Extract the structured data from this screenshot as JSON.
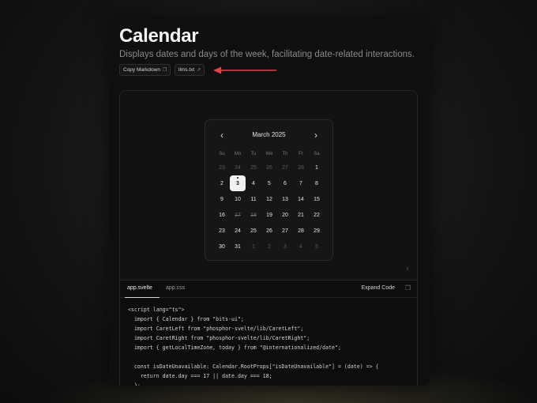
{
  "header": {
    "title": "Calendar",
    "subtitle": "Displays dates and days of the week, facilitating date-related interactions."
  },
  "actions": {
    "copy_markdown": "Copy Markdown",
    "llms": "llms.txt"
  },
  "colors": {
    "arrow": "#e0454a",
    "today_bg": "#f2f2f2"
  },
  "calendar": {
    "month": "March 2025",
    "weekdays": [
      "Su",
      "Mo",
      "Tu",
      "We",
      "Th",
      "Fr",
      "Sa"
    ],
    "weeks": [
      [
        {
          "d": "23",
          "s": "out"
        },
        {
          "d": "24",
          "s": "out"
        },
        {
          "d": "25",
          "s": "out"
        },
        {
          "d": "26",
          "s": "out"
        },
        {
          "d": "27",
          "s": "out"
        },
        {
          "d": "28",
          "s": "out"
        },
        {
          "d": "1",
          "s": ""
        }
      ],
      [
        {
          "d": "2",
          "s": ""
        },
        {
          "d": "3",
          "s": "today"
        },
        {
          "d": "4",
          "s": ""
        },
        {
          "d": "5",
          "s": ""
        },
        {
          "d": "6",
          "s": ""
        },
        {
          "d": "7",
          "s": ""
        },
        {
          "d": "8",
          "s": ""
        }
      ],
      [
        {
          "d": "9",
          "s": ""
        },
        {
          "d": "10",
          "s": ""
        },
        {
          "d": "11",
          "s": ""
        },
        {
          "d": "12",
          "s": ""
        },
        {
          "d": "13",
          "s": ""
        },
        {
          "d": "14",
          "s": ""
        },
        {
          "d": "15",
          "s": ""
        }
      ],
      [
        {
          "d": "16",
          "s": ""
        },
        {
          "d": "17",
          "s": "unavailable"
        },
        {
          "d": "18",
          "s": "unavailable"
        },
        {
          "d": "19",
          "s": ""
        },
        {
          "d": "20",
          "s": ""
        },
        {
          "d": "21",
          "s": ""
        },
        {
          "d": "22",
          "s": ""
        }
      ],
      [
        {
          "d": "23",
          "s": ""
        },
        {
          "d": "24",
          "s": ""
        },
        {
          "d": "25",
          "s": ""
        },
        {
          "d": "26",
          "s": ""
        },
        {
          "d": "27",
          "s": ""
        },
        {
          "d": "28",
          "s": ""
        },
        {
          "d": "29",
          "s": ""
        }
      ],
      [
        {
          "d": "30",
          "s": ""
        },
        {
          "d": "31",
          "s": ""
        },
        {
          "d": "1",
          "s": "out"
        },
        {
          "d": "2",
          "s": "out"
        },
        {
          "d": "3",
          "s": "out"
        },
        {
          "d": "4",
          "s": "out"
        },
        {
          "d": "5",
          "s": "out"
        }
      ]
    ]
  },
  "code_panel": {
    "tabs": [
      "app.svelte",
      "app.css"
    ],
    "active_tab": "app.svelte",
    "expand_label": "Expand Code",
    "lines": [
      "<script lang=\"ts\">",
      "  import { Calendar } from \"bits-ui\";",
      "  import CaretLeft from \"phosphor-svelte/lib/CaretLeft\";",
      "  import CaretRight from \"phosphor-svelte/lib/CaretRight\";",
      "  import { getLocalTimeZone, today } from \"@internationalized/date\";",
      "",
      "  const isDateUnavailable: Calendar.RootProps[\"isDateUnavailable\"] = (date) => {",
      "    return date.day === 17 || date.day === 18;",
      "  };"
    ]
  }
}
